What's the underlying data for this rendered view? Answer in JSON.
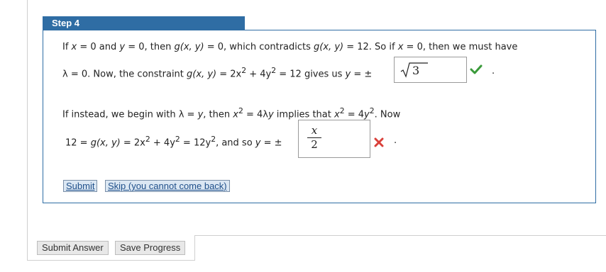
{
  "step": {
    "title": "Step 4"
  },
  "para1": {
    "l1a": "If ",
    "x": "x",
    "l1b": " = 0 and ",
    "y": "y",
    "l1c": " = 0, then ",
    "g1": "g(x, y)",
    "l1d": " = 0,  which contradicts ",
    "g2": "g(x, y)",
    "l1e": " = 12.  So if ",
    "x2": "x",
    "l1f": " = 0, then we must have",
    "l2a": "λ = 0. Now, the constraint ",
    "g3": "g(x, y)",
    "l2b": " = 2x",
    "sup1": "2",
    "l2c": " + 4y",
    "sup2": "2",
    "l2d": " = 12  gives us ",
    "y2": "y",
    "l2e": " = ±",
    "answer1": "3",
    "answer1_status": "correct",
    "tail": "."
  },
  "para2": {
    "l1a": "If instead, we begin with λ = ",
    "y": "y",
    "l1b": ", then ",
    "x": "x",
    "sup1": "2",
    "l1c": " = 4λ",
    "y2": "y",
    "l1d": "  implies that ",
    "x2": "x",
    "sup2": "2",
    "l1e": " = 4",
    "y3": "y",
    "sup3": "2",
    "l1f": ".  Now",
    "l2a": "12 = ",
    "g": "g(x, y)",
    "l2b": " = 2x",
    "sup4": "2",
    "l2c": " + 4y",
    "sup5": "2",
    "l2d": " = 12y",
    "sup6": "2",
    "l2e": ",  and so ",
    "y4": "y",
    "l2f": " = ±",
    "answer2_num": "x",
    "answer2_den": "2",
    "answer2_status": "incorrect",
    "tail": "."
  },
  "buttons": {
    "submit": "Submit",
    "skip": "Skip (you cannot come back)",
    "submit_answer": "Submit Answer",
    "save_progress": "Save Progress"
  },
  "colors": {
    "accent": "#2f6da4",
    "correct": "#3a9a3a",
    "incorrect": "#d9403a"
  },
  "icons": {
    "correct": "checkmark-icon",
    "incorrect": "x-mark-icon"
  }
}
